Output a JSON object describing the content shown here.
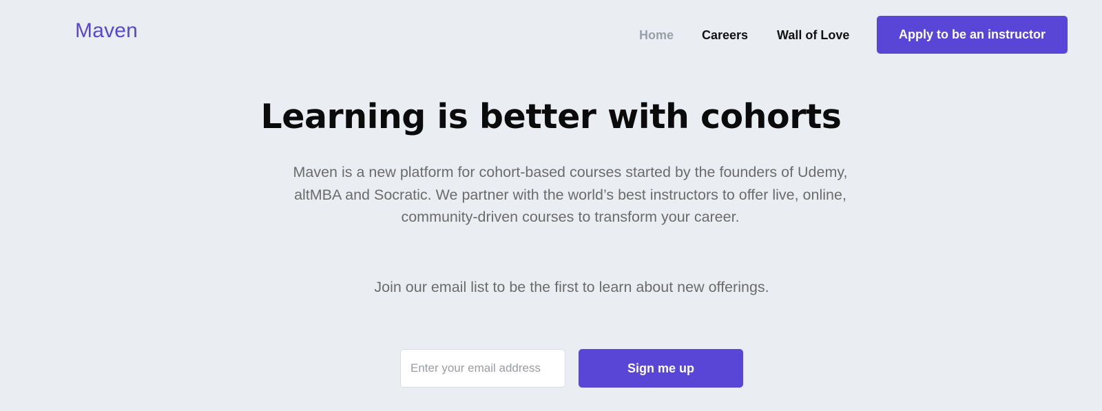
{
  "header": {
    "logo_text": "Maven",
    "nav": {
      "home": "Home",
      "careers": "Careers",
      "wall_of_love": "Wall of Love"
    },
    "cta_label": "Apply to be an instructor"
  },
  "hero": {
    "title": "Learning is better with cohorts",
    "description": "Maven is a new platform for cohort-based courses started by the founders of Udemy, altMBA and Socratic. We partner with the world’s best instructors to offer live, online, community-driven courses to transform your career.",
    "join_text": "Join our email list to be the first to learn about new offerings."
  },
  "signup": {
    "email_placeholder": "Enter your email address",
    "email_value": "",
    "button_label": "Sign me up"
  },
  "colors": {
    "accent": "#5a46d6",
    "background": "#eaedf1",
    "nav_active": "#9aa0ab"
  }
}
